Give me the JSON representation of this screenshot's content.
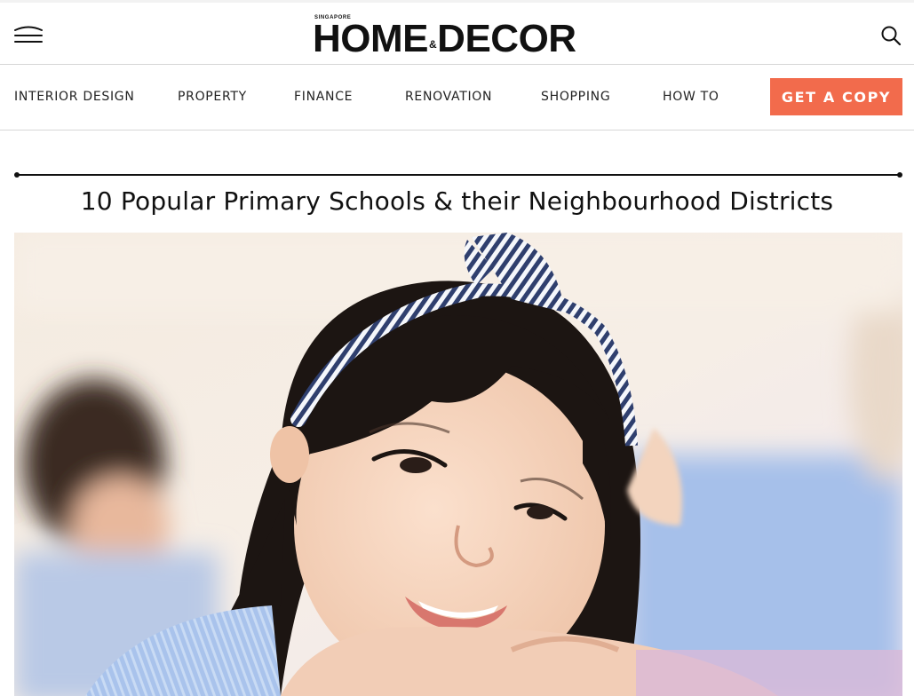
{
  "header": {
    "logo": {
      "top_text": "SINGAPORE",
      "word1": "HOME",
      "amp": "&",
      "word2": "DECOR"
    },
    "menu_icon": "hamburger-icon",
    "search_icon": "search-icon"
  },
  "nav": {
    "items": [
      {
        "label": "INTERIOR DESIGN"
      },
      {
        "label": "PROPERTY"
      },
      {
        "label": "FINANCE"
      },
      {
        "label": "RENOVATION"
      },
      {
        "label": "SHOPPING"
      },
      {
        "label": "HOW TO"
      }
    ],
    "cta_label": "GET A COPY"
  },
  "article": {
    "title": "10 Popular Primary Schools & their Neighbourhood Districts"
  },
  "colors": {
    "accent": "#f26b4c",
    "text": "#111111",
    "border": "#d6d6d6"
  }
}
